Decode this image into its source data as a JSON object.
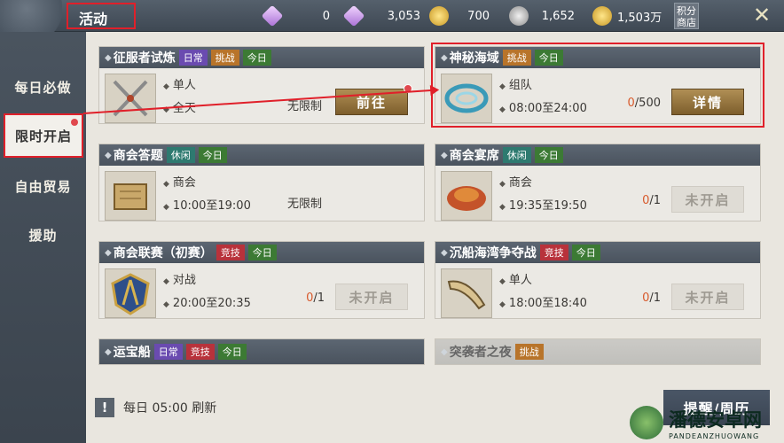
{
  "header": {
    "title": "活动",
    "shop_label_1": "积分",
    "shop_label_2": "商店"
  },
  "currencies": [
    {
      "icon": "diamond-plus-icon",
      "value": "0"
    },
    {
      "icon": "bound-diamond-icon",
      "value": "3,053"
    },
    {
      "icon": "gold-coin-plus-icon",
      "value": "700"
    },
    {
      "icon": "silver-coin-plus-icon",
      "value": "1,652"
    },
    {
      "icon": "gold-ingot-icon",
      "value": "1,503万"
    }
  ],
  "sidebar": {
    "items": [
      {
        "label": "每日必做"
      },
      {
        "label": "限时开启",
        "active": true
      },
      {
        "label": "自由贸易"
      },
      {
        "label": "援助"
      }
    ]
  },
  "cards": [
    {
      "title": "征服者试炼",
      "tags": [
        "日常",
        "挑战",
        "今日"
      ],
      "mode": "单人",
      "time": "全天",
      "limit": "无限制",
      "button": "前往",
      "icon": "crossed-swords-icon"
    },
    {
      "title": "神秘海域",
      "tags": [
        "挑战",
        "今日"
      ],
      "mode": "组队",
      "time": "08:00至24:00",
      "count_cur": "0",
      "count_max": "/500",
      "button": "详情",
      "icon": "whirlpool-icon"
    },
    {
      "title": "商会答题",
      "tags": [
        "休闲",
        "今日"
      ],
      "mode": "商会",
      "time": "10:00至19:00",
      "limit": "无限制",
      "icon": "scroll-icon"
    },
    {
      "title": "商会宴席",
      "tags": [
        "休闲",
        "今日"
      ],
      "mode": "商会",
      "time": "19:35至19:50",
      "count_cur": "0",
      "count_max": "/1",
      "button": "未开启",
      "icon": "roast-meat-icon"
    },
    {
      "title": "商会联赛（初赛）",
      "tags": [
        "竞技",
        "今日"
      ],
      "mode": "对战",
      "time": "20:00至20:35",
      "count_cur": "0",
      "count_max": "/1",
      "button": "未开启",
      "icon": "league-crest-icon"
    },
    {
      "title": "沉船海湾争夺战",
      "tags": [
        "竞技",
        "今日"
      ],
      "mode": "单人",
      "time": "18:00至18:40",
      "count_cur": "0",
      "count_max": "/1",
      "button": "未开启",
      "icon": "horn-icon"
    },
    {
      "title": "运宝船",
      "tags": [
        "日常",
        "竞技",
        "今日"
      ]
    },
    {
      "title": "突袭者之夜",
      "tags": [
        "挑战"
      ]
    }
  ],
  "footer": {
    "refresh": "每日 05:00 刷新",
    "remind_button": "提醒/周历"
  },
  "watermark": {
    "text": "潘德安卓网",
    "sub": "PANDEANZHUOWANG"
  }
}
